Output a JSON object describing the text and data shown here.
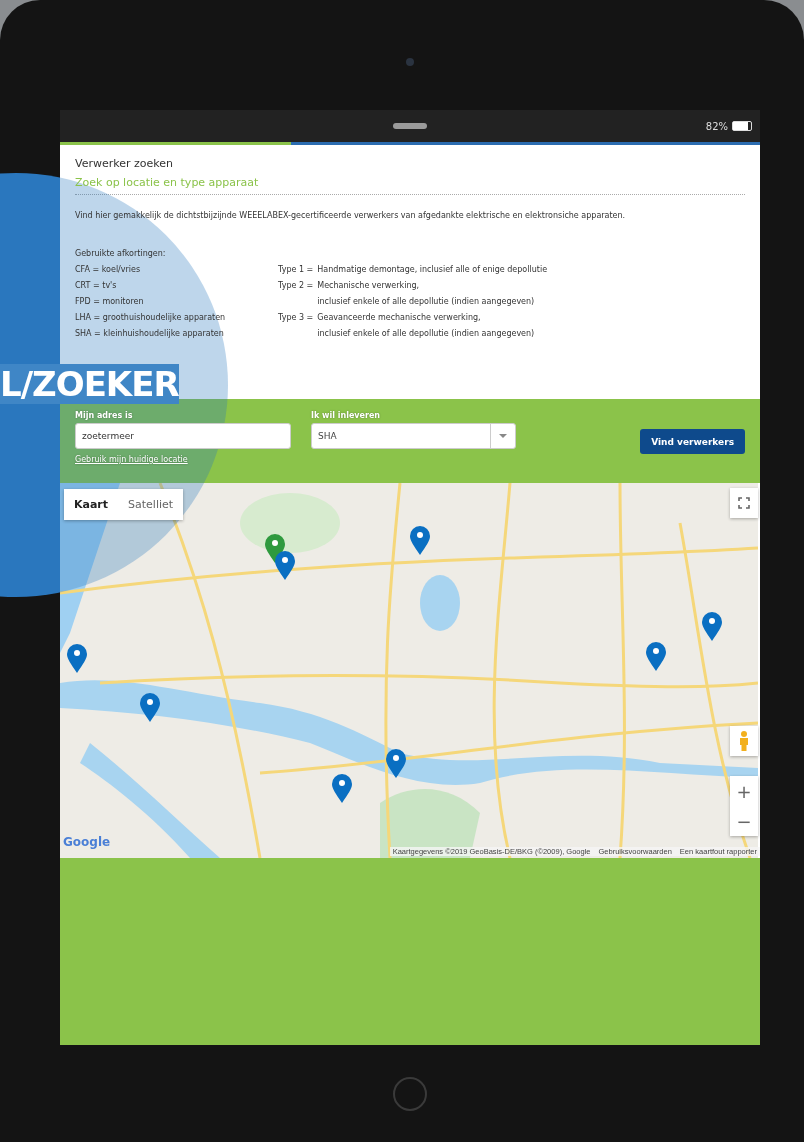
{
  "status_bar": {
    "battery": "82%"
  },
  "page": {
    "progress": {
      "level": 0.33
    },
    "title": "Verwerker zoeken",
    "subtitle": "Zoek op locatie en type apparaat",
    "intro": "Vind hier gemakkelijk de dichtstbijzijnde WEEELABEX-gecertificeerde verwerkers van afgedankte elektrische en elektronsiche apparaten.",
    "abbreviations_heading": "Gebruikte afkortingen:",
    "abbreviations": [
      "CFA = koel/vries",
      "CRT = tv's",
      "FPD = monitoren",
      "LHA = groothuishoudelijke apparaten",
      "SHA = kleinhuishoudelijke apparaten"
    ],
    "types": [
      {
        "label": "Type 1 =",
        "lines": [
          "Handmatige demontage, inclusief alle of enige depollutie"
        ]
      },
      {
        "label": "Type 2 =",
        "lines": [
          "Mechanische verwerking,",
          "inclusief enkele of alle depollutie (indien aangegeven)"
        ]
      },
      {
        "label": "Type 3 =",
        "lines": [
          "Geavanceerde mechanische verwerking,",
          "inclusief enkele of alle depollutie (indien aangegeven)"
        ]
      }
    ]
  },
  "form": {
    "address_label": "Mijn adres is",
    "address_value": "zoetermeer",
    "location_link": "Gebruik mijn huidige locatie",
    "device_label": "Ik wil inleveren",
    "device_value": "SHA",
    "submit": "Vind verwerkers"
  },
  "map": {
    "tabs": [
      {
        "label": "Kaart",
        "selected": true
      },
      {
        "label": "Satelliet",
        "selected": false
      }
    ],
    "markers": [
      {
        "color": "#2e9a3e"
      },
      {
        "color": "#0a6fc2"
      },
      {
        "color": "#0a6fc2"
      },
      {
        "color": "#0a6fc2"
      },
      {
        "color": "#0a6fc2"
      },
      {
        "color": "#0a6fc2"
      },
      {
        "color": "#0a6fc2"
      },
      {
        "color": "#0a6fc2"
      },
      {
        "color": "#0a6fc2"
      }
    ],
    "zoom_in": "+",
    "zoom_out": "−",
    "logo": "Google",
    "attribution": "Kaartgegevens ©2019 GeoBasis-DE/BKG (©2009), Google",
    "terms": "Gebruiksvoorwaarden",
    "report": "Een kaartfout rapporter"
  },
  "overlay": {
    "text": "L/ZOEKER"
  }
}
